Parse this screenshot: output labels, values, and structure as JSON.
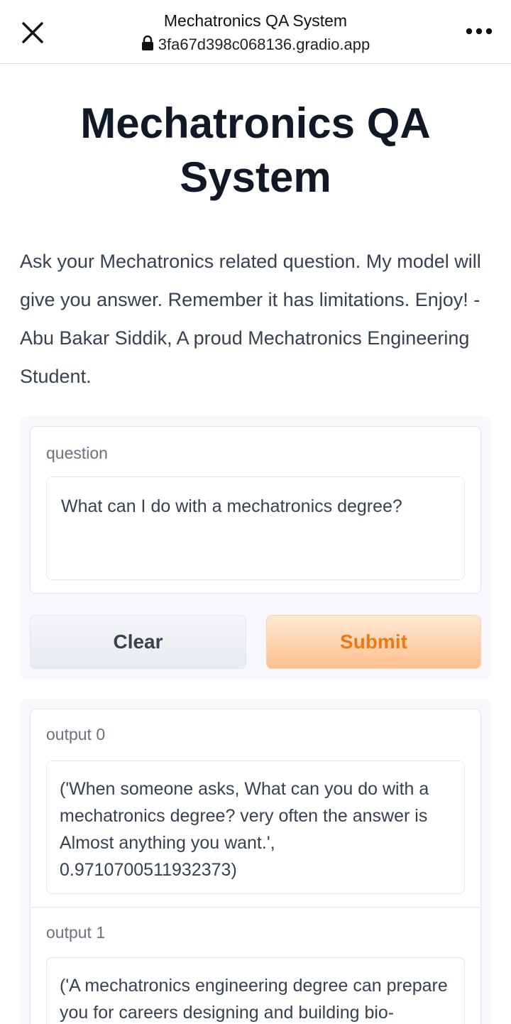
{
  "browser": {
    "title": "Mechatronics QA System",
    "url": "3fa67d398c068136.gradio.app",
    "icons": [
      "close-icon",
      "lock-icon",
      "more-options-icon"
    ]
  },
  "page": {
    "title": "Mechatronics QA System",
    "description": "Ask your Mechatronics related question. My model will give you answer. Remember it has limitations. Enjoy! - Abu Bakar Siddik, A proud Mechatronics Engineering Student."
  },
  "input": {
    "label": "question",
    "value": "What can I do with a mechatronics degree?"
  },
  "buttons": {
    "clear": "Clear",
    "submit": "Submit"
  },
  "outputs": [
    {
      "label": "output 0",
      "value": "('When someone asks, What can you do with a mechatronics degree? very often the answer is Almost anything you want.', 0.9710700511932373)"
    },
    {
      "label": "output 1",
      "value": "('A mechatronics engineering degree can prepare you for careers designing and building bio-"
    }
  ],
  "colors": {
    "accent": "#ea7a14",
    "submit_bg": "#fdc08e",
    "panel_bg": "#f6f8fb"
  }
}
